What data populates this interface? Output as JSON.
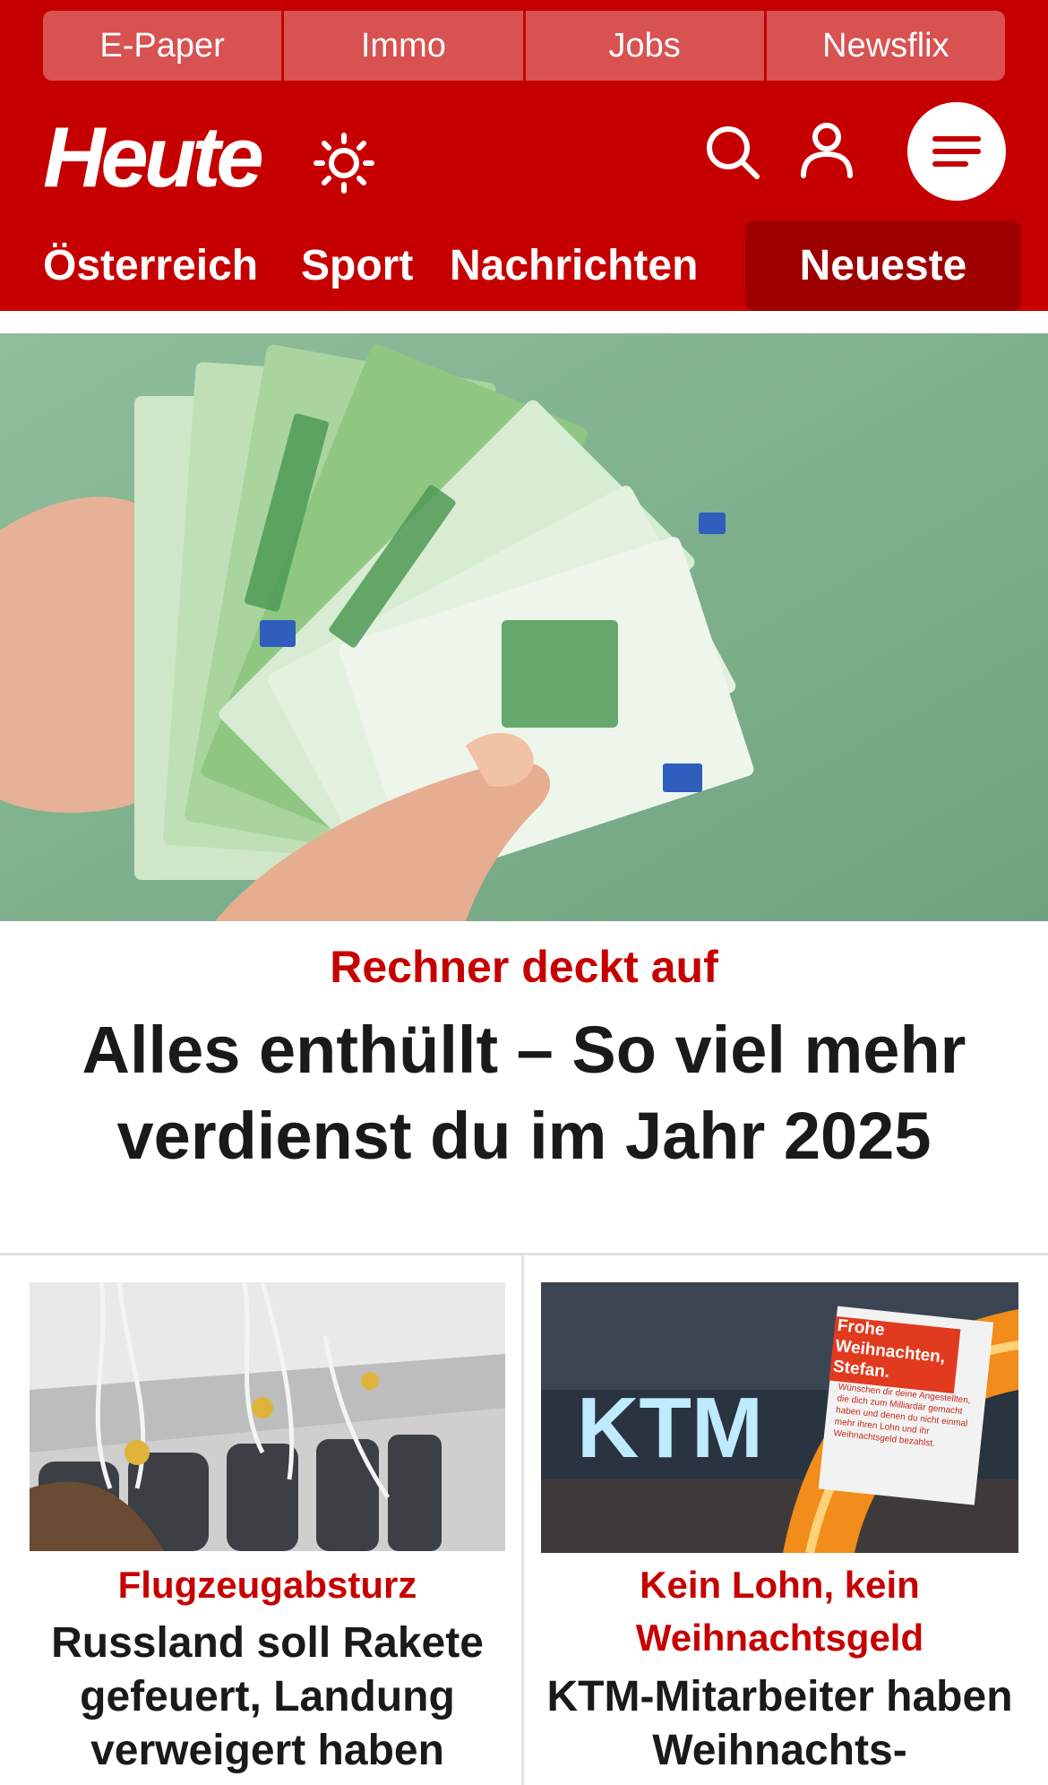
{
  "top_links": [
    "E-Paper",
    "Immo",
    "Jobs",
    "Newsflix"
  ],
  "brand": {
    "logo_text": "Heute",
    "accent": "#c60000",
    "accent_dark": "#9e0000"
  },
  "nav": {
    "items": [
      "Österreich",
      "Sport",
      "Nachrichten"
    ],
    "active": "Neueste"
  },
  "icons": [
    "sun-icon",
    "search-icon",
    "user-icon",
    "menu-icon"
  ],
  "hero": {
    "kicker": "Rechner deckt auf",
    "title": "Alles enthüllt – So viel mehr verdienst du im Jahr 2025"
  },
  "cards": [
    {
      "kicker": "Flugzeugabsturz",
      "title": "Russland soll Rakete gefeuert, Landung verweigert haben"
    },
    {
      "kicker": "Kein Lohn, kein Weihnachtsgeld",
      "title": "KTM-Mitarbeiter haben Weihnachts-",
      "image_sign_logo": "KTM",
      "image_sign_text": "Frohe Weihnachten, Stefan.",
      "image_sign_body": "Wünschen dir deine Angestellten, die dich zum Milliardär gemacht haben und denen du nicht einmal mehr ihren Lohn und ihr Weihnachtsgeld bezahlst."
    }
  ]
}
